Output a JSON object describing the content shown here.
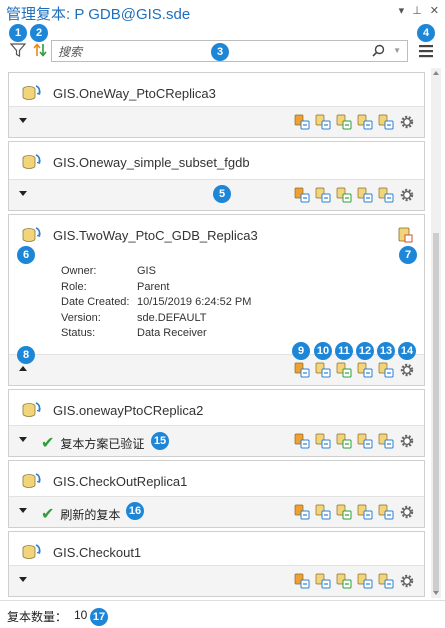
{
  "title": "管理复本: P  GDB@GIS.sde",
  "title_buttons": {
    "menu": "▾",
    "pin": "⊥",
    "close": "✕"
  },
  "search": {
    "placeholder": "搜索",
    "value": ""
  },
  "colors": {
    "accent": "#1e86d6",
    "title": "#1f6fbd",
    "check": "#2e9d3a",
    "footer_bg": "#f4f4f4"
  },
  "icons": {
    "filter": "filter-icon",
    "sort": "sort-icon",
    "search": "search-icon",
    "menu": "hamburger-menu-icon",
    "settings": "gear-icon"
  },
  "replicas": [
    {
      "name": "GIS.OneWay_PtoCReplica3",
      "expanded": false,
      "status": ""
    },
    {
      "name": "GIS.Oneway_simple_subset_fgdb",
      "expanded": false,
      "status": ""
    },
    {
      "name": "GIS.TwoWay_PtoC_GDB_Replica3",
      "expanded": true,
      "status": "",
      "details": [
        {
          "label": "Owner:",
          "value": "GIS"
        },
        {
          "label": "Role:",
          "value": "Parent"
        },
        {
          "label": "Date Created:",
          "value": "10/15/2019 6:24:52 PM"
        },
        {
          "label": "Version:",
          "value": "sde.DEFAULT"
        },
        {
          "label": "Status:",
          "value": "Data Receiver"
        }
      ]
    },
    {
      "name": "GIS.onewayPtoCReplica2",
      "expanded": false,
      "status": "复本方案已验证"
    },
    {
      "name": "GIS.CheckOutReplica1",
      "expanded": false,
      "status": "刷新的复本"
    },
    {
      "name": "GIS.Checkout1",
      "expanded": false,
      "status": ""
    }
  ],
  "footer": {
    "label": "复本数量：",
    "count": "10"
  },
  "callouts": [
    "1",
    "2",
    "3",
    "4",
    "5",
    "6",
    "7",
    "8",
    "9",
    "10",
    "11",
    "12",
    "13",
    "14",
    "15",
    "16",
    "17"
  ]
}
